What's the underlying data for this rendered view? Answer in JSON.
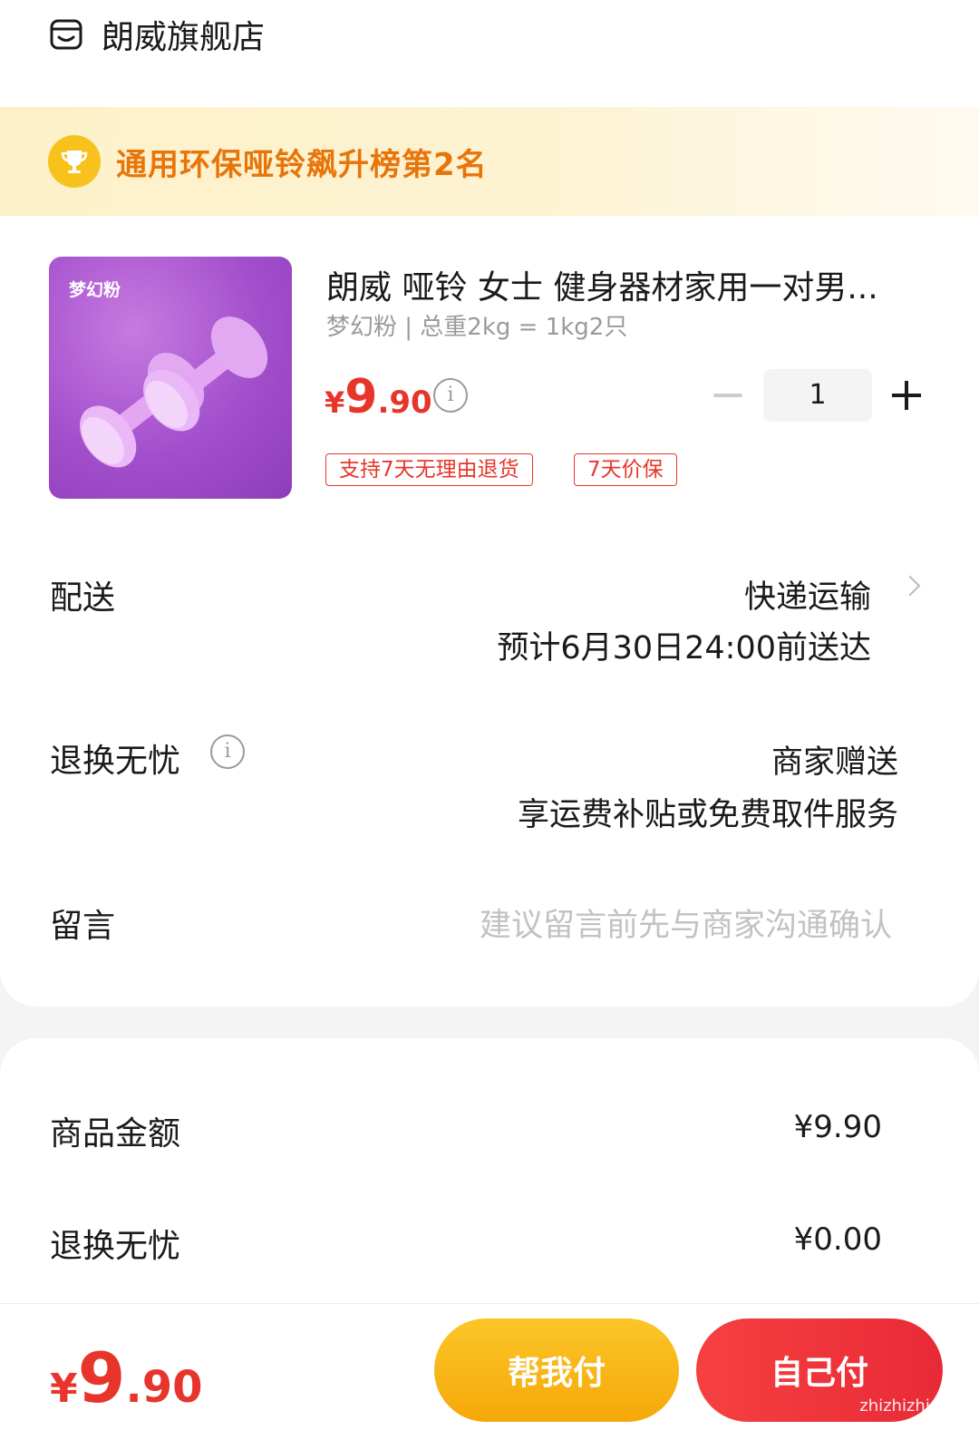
{
  "shop": {
    "name": "朗威旗舰店"
  },
  "rank_banner": {
    "text": "通用环保哑铃飙升榜第2名"
  },
  "product": {
    "image_label": "梦幻粉",
    "title": "朗威 哑铃 女士 健身器材家用一对男...",
    "spec": "梦幻粉 | 总重2kg = 1kg2只",
    "price": {
      "currency": "¥",
      "integer": "9",
      "decimal": ".90"
    },
    "quantity": "1",
    "tags": [
      "支持7天无理由退货",
      "7天价保"
    ]
  },
  "delivery": {
    "label": "配送",
    "method": "快递运输",
    "estimate": "预计6月30日24:00前送达"
  },
  "returns": {
    "label": "退换无忧",
    "value": "商家赠送",
    "detail": "享运费补贴或免费取件服务"
  },
  "message": {
    "label": "留言",
    "placeholder": "建议留言前先与商家沟通确认"
  },
  "summary": {
    "goods_label": "商品金额",
    "goods_amount": "¥9.90",
    "returns_label": "退换无忧",
    "returns_amount": "¥0.00"
  },
  "bottom": {
    "total": {
      "currency": "¥",
      "integer": "9",
      "decimal": ".90"
    },
    "help_pay": "帮我付",
    "self_pay": "自己付"
  },
  "watermark": "zhizhizhi.com",
  "colors": {
    "price_red": "#e8352b",
    "rank_orange": "#e8750a",
    "help_yellow": "#f8b514",
    "pay_red": "#ee3039"
  }
}
